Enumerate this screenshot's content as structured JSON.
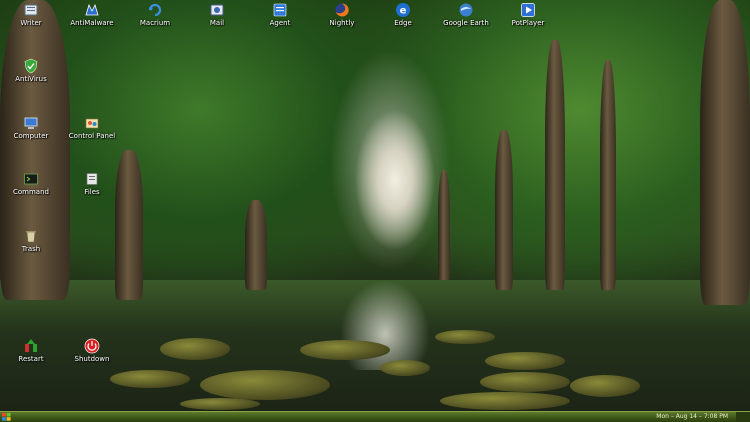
{
  "desktop": {
    "top_icons": [
      {
        "label": "Writer",
        "icon": "writer-icon"
      },
      {
        "label": "AntiMalware",
        "icon": "antimalware-icon"
      },
      {
        "label": "Macrium",
        "icon": "macrium-icon"
      },
      {
        "label": "Mail",
        "icon": "mail-icon"
      },
      {
        "label": "Agent",
        "icon": "agent-icon"
      },
      {
        "label": "Nightly",
        "icon": "firefox-nightly-icon"
      },
      {
        "label": "Edge",
        "icon": "edge-icon"
      },
      {
        "label": "Google Earth",
        "icon": "google-earth-icon"
      },
      {
        "label": "PotPlayer",
        "icon": "potplayer-icon"
      }
    ],
    "left_icons": [
      {
        "label": "AntiVirus",
        "icon": "antivirus-shield-icon"
      },
      {
        "label": "Computer",
        "icon": "computer-icon"
      },
      {
        "label": "Control Panel",
        "icon": "control-panel-icon"
      },
      {
        "label": "Command",
        "icon": "command-prompt-icon"
      },
      {
        "label": "Files",
        "icon": "files-icon"
      },
      {
        "label": "Trash",
        "icon": "trash-icon"
      },
      {
        "label": "Restart",
        "icon": "restart-icon"
      },
      {
        "label": "Shutdown",
        "icon": "shutdown-icon"
      }
    ]
  },
  "taskbar": {
    "start_icon": "windows-start-icon",
    "clock": "Mon – Aug 14 – 7:08 PM"
  },
  "colors": {
    "taskbar": "#3b5416",
    "label_text": "#ffffff"
  }
}
